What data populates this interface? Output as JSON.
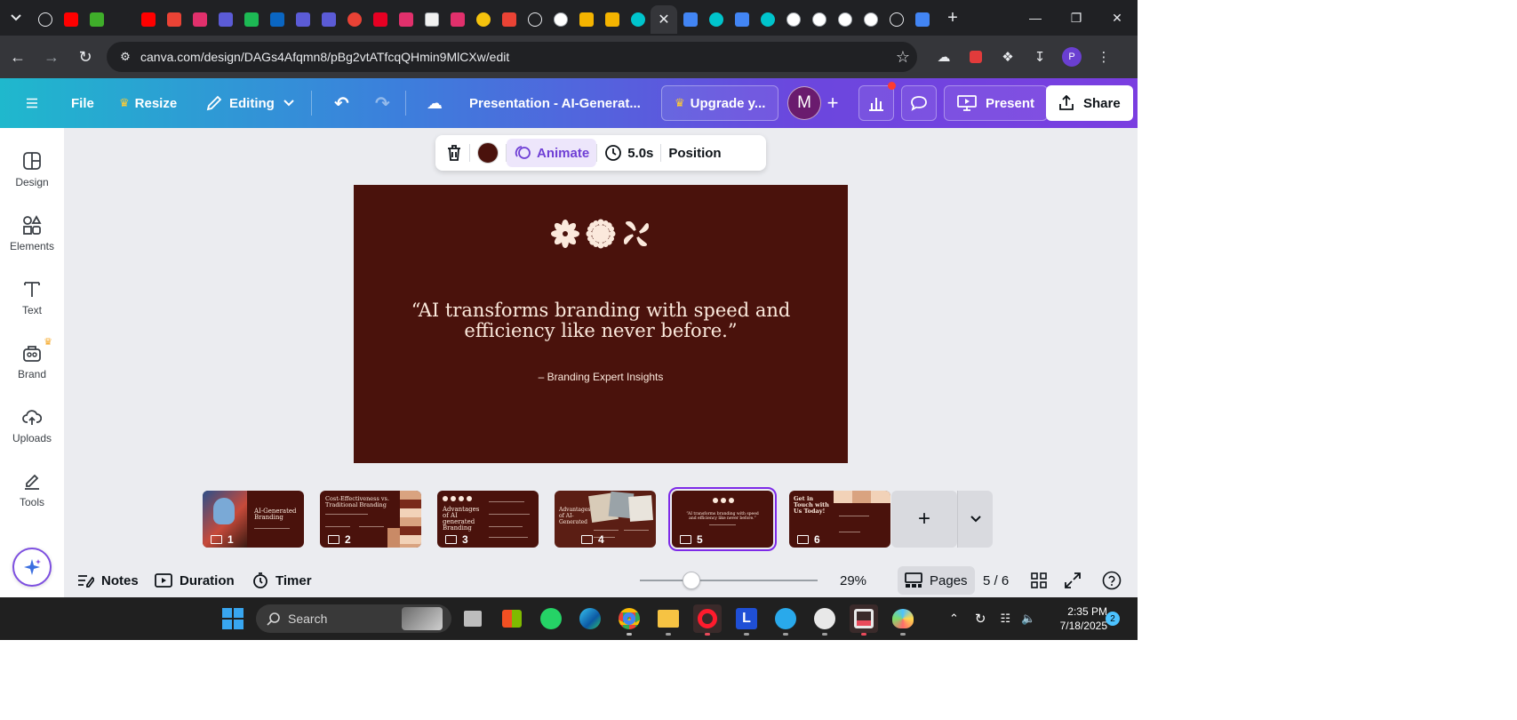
{
  "browser": {
    "url": "canva.com/design/DAGs4Afqmn8/pBg2vtATfcqQHmin9MlCXw/edit",
    "tabs": [
      {
        "icon": "openai-icon",
        "color": "#202124"
      },
      {
        "icon": "youtube-icon",
        "color": "#ff0000"
      },
      {
        "icon": "leaf-icon",
        "color": "#3fae2a"
      },
      {
        "icon": "script-f-icon",
        "color": "#202124"
      },
      {
        "icon": "youtube-icon",
        "color": "#ff0000"
      },
      {
        "icon": "gmail-icon",
        "color": "#ea4335"
      },
      {
        "icon": "instagram-icon",
        "color": "#e1306c"
      },
      {
        "icon": "pinterest-p-icon",
        "color": "#5b5bd6"
      },
      {
        "icon": "green-x-icon",
        "color": "#1db954"
      },
      {
        "icon": "linkedin-icon",
        "color": "#0a66c2"
      },
      {
        "icon": "pinterest-p-icon",
        "color": "#5b5bd6"
      },
      {
        "icon": "pinterest-p-icon",
        "color": "#5b5bd6"
      },
      {
        "icon": "chrome-red-icon",
        "color": "#e94235"
      },
      {
        "icon": "pinterest-icon",
        "color": "#e60023"
      },
      {
        "icon": "instagram-icon",
        "color": "#e1306c"
      },
      {
        "icon": "notebook-icon",
        "color": "#f1f1f1"
      },
      {
        "icon": "instagram-icon",
        "color": "#e1306c"
      },
      {
        "icon": "v-logo-icon",
        "color": "#f4c20d"
      },
      {
        "icon": "gmail-icon",
        "color": "#ea4335"
      },
      {
        "icon": "openai-icon",
        "color": "#202124"
      },
      {
        "icon": "google-icon",
        "color": "#ffffff"
      },
      {
        "icon": "slides-icon",
        "color": "#f4b400"
      },
      {
        "icon": "play-icon",
        "color": "#f4b400"
      },
      {
        "icon": "canva-icon",
        "color": "#00c4cc"
      },
      {
        "icon": "close-icon",
        "color": "#35363a",
        "active": true
      },
      {
        "icon": "calendar-icon",
        "color": "#4285f4"
      },
      {
        "icon": "canva-icon",
        "color": "#00c4cc"
      },
      {
        "icon": "calendar-icon",
        "color": "#4285f4"
      },
      {
        "icon": "canva-icon",
        "color": "#00c4cc"
      },
      {
        "icon": "google-icon",
        "color": "#ffffff"
      },
      {
        "icon": "b-logo-icon",
        "color": "#ffffff"
      },
      {
        "icon": "swirl-icon",
        "color": "#ffffff"
      },
      {
        "icon": "google-icon",
        "color": "#ffffff"
      },
      {
        "icon": "openai-icon",
        "color": "#202124"
      },
      {
        "icon": "docs-icon",
        "color": "#4285f4"
      }
    ],
    "profile_initial": "P"
  },
  "header": {
    "file_label": "File",
    "resize_label": "Resize",
    "editing_label": "Editing",
    "doc_title": "Presentation - AI-Generat...",
    "upgrade_label": "Upgrade y...",
    "avatar_initial": "M",
    "present_label": "Present",
    "share_label": "Share",
    "gradient_colors": [
      "#1fb8cd",
      "#6b47de",
      "#7a3ee0"
    ]
  },
  "sidebar": {
    "items": [
      {
        "label": "Design",
        "icon": "design-layout-icon"
      },
      {
        "label": "Elements",
        "icon": "elements-shapes-icon"
      },
      {
        "label": "Text",
        "icon": "text-t-icon"
      },
      {
        "label": "Brand",
        "icon": "brand-briefcase-icon",
        "premium": true
      },
      {
        "label": "Uploads",
        "icon": "upload-cloud-icon"
      },
      {
        "label": "Tools",
        "icon": "tools-pen-icon"
      }
    ]
  },
  "context_toolbar": {
    "animate_label": "Animate",
    "duration_label": "5.0s",
    "position_label": "Position",
    "fill_color": "#4a120c"
  },
  "slide": {
    "quote": "“AI transforms branding with speed and efficiency like never before.”",
    "attribution": "– Branding Expert Insights",
    "background": "#4a120c",
    "text_color": "#fbe9dc",
    "icons": [
      "flower-icon",
      "sunburst-icon",
      "petal-cross-icon"
    ]
  },
  "pages": {
    "thumbnails": [
      {
        "number": "1",
        "title": "AI-Generated Branding"
      },
      {
        "number": "2",
        "title": "Cost-Effectiveness vs. Traditional Branding"
      },
      {
        "number": "3",
        "title": "Advantages of AI generated Branding"
      },
      {
        "number": "4",
        "title": "Advantages of AI- Generated"
      },
      {
        "number": "5",
        "title": "“AI transforms branding with speed and efficiency like never before.”",
        "selected": true
      },
      {
        "number": "6",
        "title": "Get in Touch with Us Today!"
      }
    ]
  },
  "bottom_bar": {
    "notes_label": "Notes",
    "duration_label": "Duration",
    "timer_label": "Timer",
    "zoom_percent": "29%",
    "zoom_fraction": 0.29,
    "pages_label": "Pages",
    "page_counter": "5 / 6"
  },
  "taskbar": {
    "search_placeholder": "Search",
    "apps": [
      "file-explorer-icon",
      "store-icon",
      "whatsapp-icon",
      "edge-icon",
      "chrome-icon",
      "folder-icon",
      "opera-icon",
      "l-app-icon",
      "telegram-icon",
      "clock-app-icon",
      "snipping-icon",
      "paint-icon"
    ],
    "time": "2:35 PM",
    "date": "7/18/2025",
    "notification_count": "2"
  }
}
